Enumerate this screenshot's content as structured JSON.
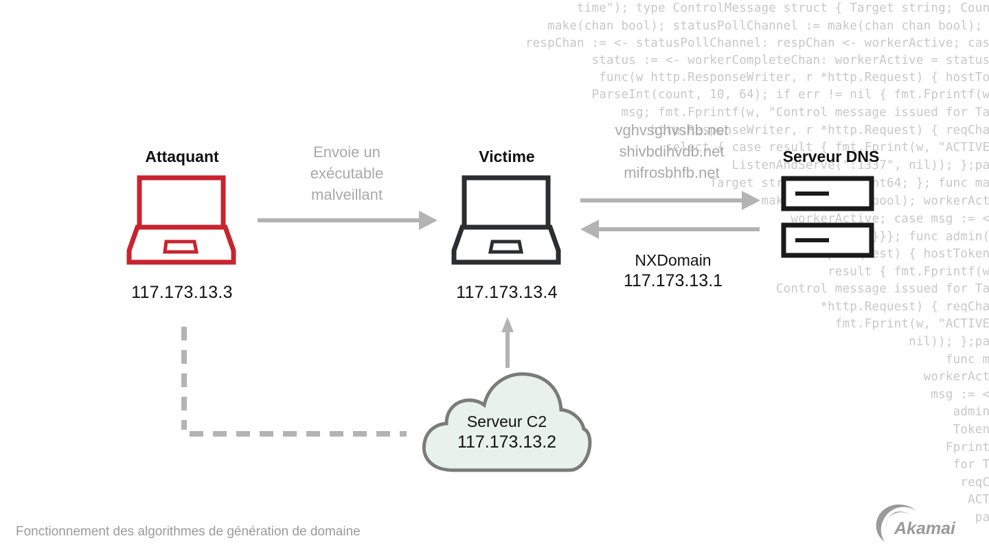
{
  "background_code": [
    "time\"); type ControlMessage struct { Target string; Count",
    "make(chan bool); statusPollChannel := make(chan chan bool); w",
    "respChan := <- statusPollChannel: respChan <- workerActive; case",
    "status := <- workerCompleteChan: workerActive = status;",
    "func(w http.ResponseWriter, r *http.Request) { hostTok",
    "ParseInt(count, 10, 64); if err != nil { fmt.Fprintf(w,",
    "msg; fmt.Fprintf(w, \"Control message issued for Tar",
    "http.ResponseWriter, r *http.Request) { reqChan",
    "select { case result { fmt.Fprint(w, \"ACTIVE\"",
    "ListenAndServe(\":1337\", nil)); };pac",
    "Target string; Count int64; }; func mai",
    "make(chan chan bool); workerActi",
    "workerActive; case msg := <-",
    "status; }}}; func admin(c",
    "r *http.Request) { hostTokens",
    "result { fmt.Fprintf(w,",
    "Control message issued for Tar",
    "*http.Request) { reqChan",
    "fmt.Fprint(w, \"ACTIVE\"",
    "nil)); };pac",
    "func ma",
    "workerActi",
    "msg := <-",
    "admin(",
    "Tokens",
    "Fprintf",
    "for Ta",
    "reqCh",
    "ACTI",
    "pac"
  ],
  "nodes": {
    "attacker": {
      "title": "Attaquant",
      "ip": "117.173.13.3",
      "color": "#c8242f"
    },
    "victim": {
      "title": "Victime",
      "ip": "117.173.13.4",
      "color": "#2b2d31"
    },
    "dns": {
      "title": "Serveur DNS",
      "color": "#1a1a1a"
    },
    "c2": {
      "title": "Serveur C2",
      "ip": "117.173.13.2",
      "fill": "#e8f1ec",
      "stroke": "#7b7b7b"
    }
  },
  "edges": {
    "attacker_to_victim": {
      "label_lines": [
        "Envoie un",
        "exécutable",
        "malveillant"
      ]
    },
    "victim_to_dns": {
      "domains": [
        "vghvsghvshb.net",
        "shivbdihvdb.net",
        "mifrosbhfb.net"
      ]
    },
    "dns_to_victim": {
      "label_lines": [
        "NXDomain",
        "117.173.13.1"
      ]
    }
  },
  "colors": {
    "arrow": "#b3b3b3",
    "caption": "#9a9a9a"
  },
  "caption": "Fonctionnement des algorithmes de génération de domaine",
  "logo": {
    "name": "Akamai"
  }
}
